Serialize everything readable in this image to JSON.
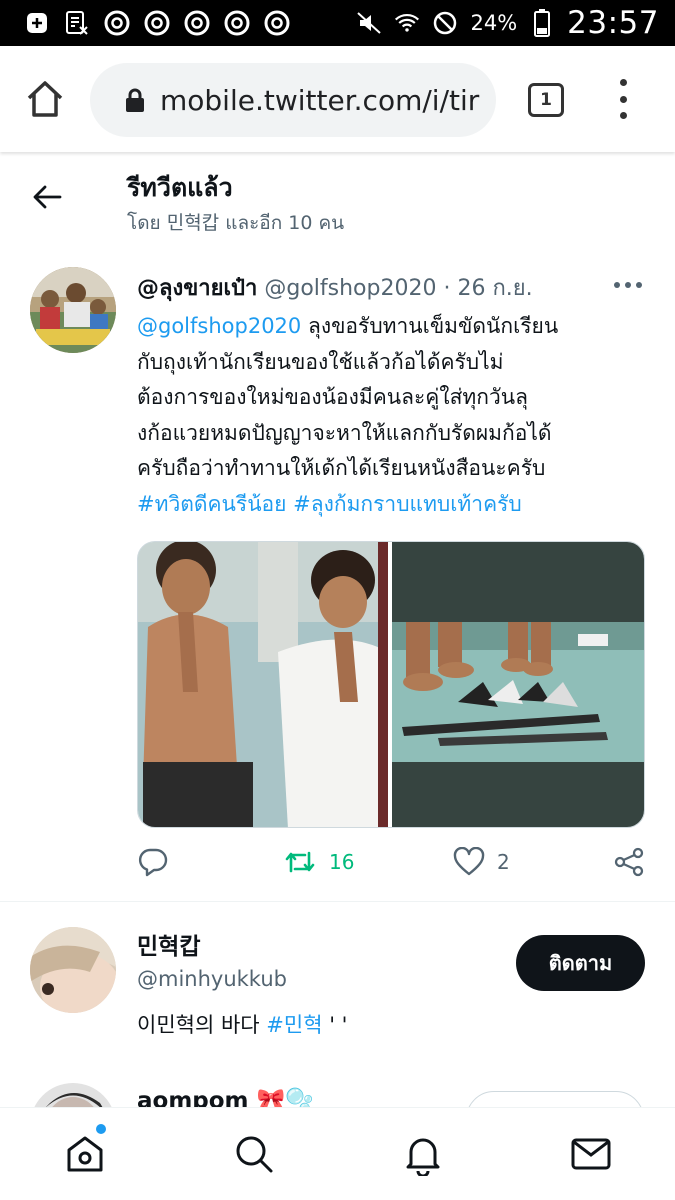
{
  "status_bar": {
    "battery_percent": "24%",
    "time": "23:57"
  },
  "browser": {
    "url": "mobile.twitter.com/i/tir",
    "tab_count": "1"
  },
  "header": {
    "title": "รีทวีตแล้ว",
    "subtitle": "โดย 민혁캅 และอีก 10 คน"
  },
  "tweet": {
    "display_name": "@ลุงขายเป๋า",
    "handle": "@golfshop2020",
    "separator": "·",
    "date": "26 ก.ย.",
    "mention": "@golfshop2020",
    "text_lines": [
      " ลุงขอรับทานเข็มขัดนักเรียน",
      "กับถุงเท้านักเรียนของใช้แล้วก้อได้ครับไม่",
      "ต้องการของใหม่ของน้องมีคนละคู่ใส่ทุกวันลุ",
      "งก้อแวยหมดปัญญาจะหาให้แลกกับรัดผมก้อได้",
      "ครับถือว่าทำทานให้เด้กได้เรียนหนังสือนะครับ"
    ],
    "hashtag_1": "#ทวิตดีคนรีน้อย",
    "hashtag_2": "#ลุงก้มกราบแทบเท้าครับ",
    "retweet_count": "16",
    "like_count": "2"
  },
  "follow_cards": [
    {
      "name": "민혁캅",
      "handle": "@minhyukkub",
      "bio_text": "이민혁의 바다 ",
      "bio_hashtag": "#민혁",
      "bio_tail": " '   '",
      "button_label": "ติดตาม"
    },
    {
      "name": "aompom",
      "emoji": "🎀🫧"
    }
  ],
  "colors": {
    "accent": "#1d9bf0",
    "retweet_green": "#00ba7c",
    "text_primary": "#0f1419",
    "text_secondary": "#536471"
  },
  "icons": [
    "home-icon",
    "lock-icon",
    "tabs-icon",
    "more-vert-icon",
    "back-arrow-icon",
    "reply-icon",
    "retweet-icon",
    "like-icon",
    "share-icon",
    "search-icon",
    "notifications-icon",
    "messages-icon"
  ]
}
